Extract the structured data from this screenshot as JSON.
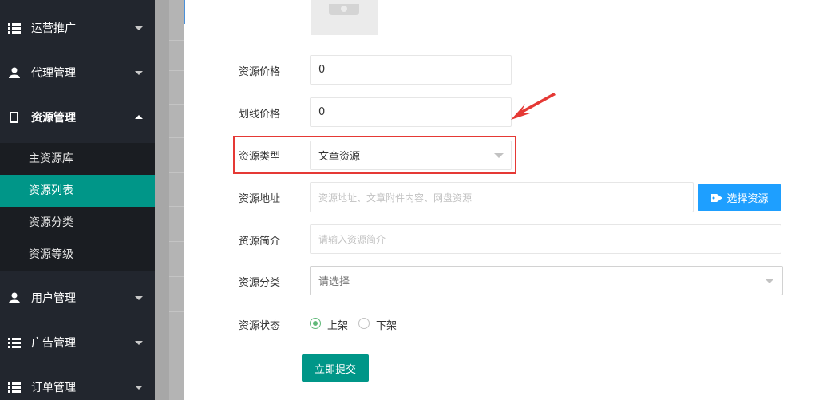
{
  "sidebar": {
    "menu": [
      {
        "label": "运营推广",
        "icon": "list-icon"
      },
      {
        "label": "代理管理",
        "icon": "users-icon"
      },
      {
        "label": "资源管理",
        "icon": "book-icon"
      },
      {
        "label": "用户管理",
        "icon": "user-icon"
      },
      {
        "label": "广告管理",
        "icon": "list-icon"
      },
      {
        "label": "订单管理",
        "icon": "list-icon"
      }
    ],
    "submenu": [
      {
        "label": "主资源库",
        "active": false
      },
      {
        "label": "资源列表",
        "active": true
      },
      {
        "label": "资源分类",
        "active": false
      },
      {
        "label": "资源等级",
        "active": false
      }
    ]
  },
  "form": {
    "price": {
      "label": "资源价格",
      "value": "0"
    },
    "strike_price": {
      "label": "划线价格",
      "value": "0"
    },
    "type": {
      "label": "资源类型",
      "value": "文章资源"
    },
    "address": {
      "label": "资源地址",
      "placeholder": "资源地址、文章附件内容、网盘资源",
      "button": "选择资源"
    },
    "intro": {
      "label": "资源简介",
      "placeholder": "请输入资源简介"
    },
    "category": {
      "label": "资源分类",
      "value": "请选择"
    },
    "status": {
      "label": "资源状态",
      "options": [
        "上架",
        "下架"
      ],
      "selected": "上架"
    },
    "submit": "立即提交"
  },
  "colors": {
    "sidebar_bg": "#22262e",
    "active": "#009688",
    "primary_blue": "#1e9fff",
    "highlight_red": "#e53935"
  }
}
